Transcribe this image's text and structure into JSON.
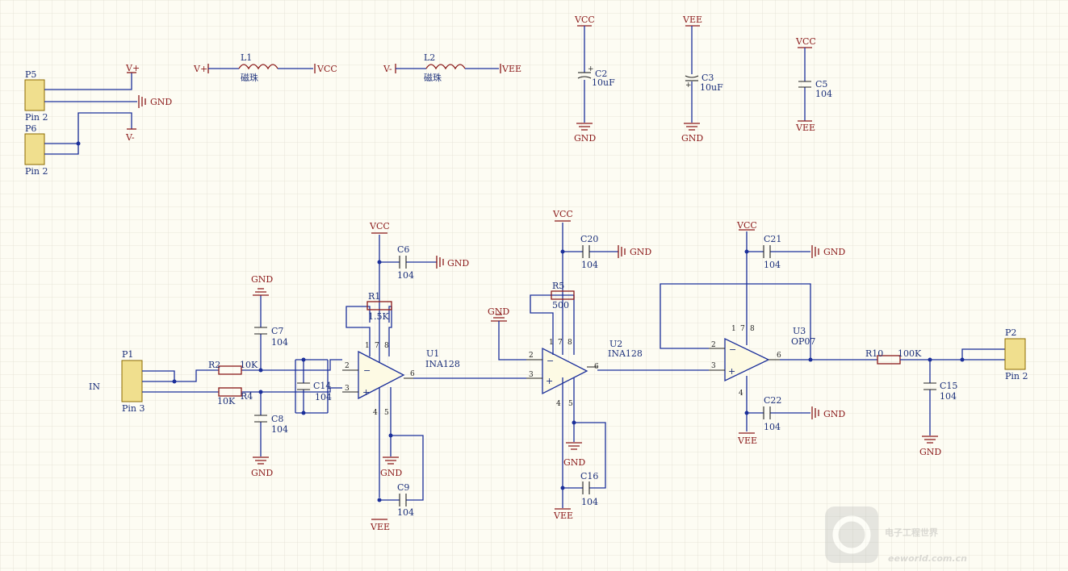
{
  "connectors": {
    "p5": {
      "ref": "P5",
      "pin": "Pin 2"
    },
    "p6": {
      "ref": "P6",
      "pin": "Pin 2"
    },
    "p1": {
      "ref": "P1",
      "pin": "Pin 3",
      "net": "IN"
    },
    "p2": {
      "ref": "P2",
      "pin": "Pin 2"
    }
  },
  "power_labels": {
    "vplus": "V+",
    "vminus": "V-",
    "vcc": "VCC",
    "vee": "VEE",
    "gnd": "GND"
  },
  "inductors": [
    {
      "ref": "L1",
      "value": "磁珠",
      "in": "V+",
      "out": "VCC"
    },
    {
      "ref": "L2",
      "value": "磁珠",
      "in": "V-",
      "out": "VEE"
    }
  ],
  "capacitors": {
    "c2": {
      "ref": "C2",
      "value": "10uF"
    },
    "c3": {
      "ref": "C3",
      "value": "10uF"
    },
    "c5": {
      "ref": "C5",
      "value": "104"
    },
    "c6": {
      "ref": "C6",
      "value": "104"
    },
    "c7": {
      "ref": "C7",
      "value": "104"
    },
    "c8": {
      "ref": "C8",
      "value": "104"
    },
    "c9": {
      "ref": "C9",
      "value": "104"
    },
    "c14": {
      "ref": "C14",
      "value": "104"
    },
    "c15": {
      "ref": "C15",
      "value": "104"
    },
    "c16": {
      "ref": "C16",
      "value": "104"
    },
    "c20": {
      "ref": "C20",
      "value": "104"
    },
    "c21": {
      "ref": "C21",
      "value": "104"
    },
    "c22": {
      "ref": "C22",
      "value": "104"
    }
  },
  "resistors": {
    "r1": {
      "ref": "R1",
      "value": "1.5K"
    },
    "r2": {
      "ref": "R2",
      "value": "10K"
    },
    "r4": {
      "ref": "R4",
      "value": "10K"
    },
    "r5": {
      "ref": "R5",
      "value": "500"
    },
    "r10": {
      "ref": "R10",
      "value": "100K"
    }
  },
  "amplifiers": {
    "u1": {
      "ref": "U1",
      "part": "INA128"
    },
    "u2": {
      "ref": "U2",
      "part": "INA128"
    },
    "u3": {
      "ref": "U3",
      "part": "OP07"
    }
  },
  "pins": {
    "p1": "1",
    "p2": "2",
    "p3": "3",
    "p4": "4",
    "p5": "5",
    "p6": "6",
    "p7": "7",
    "p8": "8"
  },
  "watermark": {
    "cn": "电子工程世界",
    "url": "eeworld.com.cn"
  }
}
